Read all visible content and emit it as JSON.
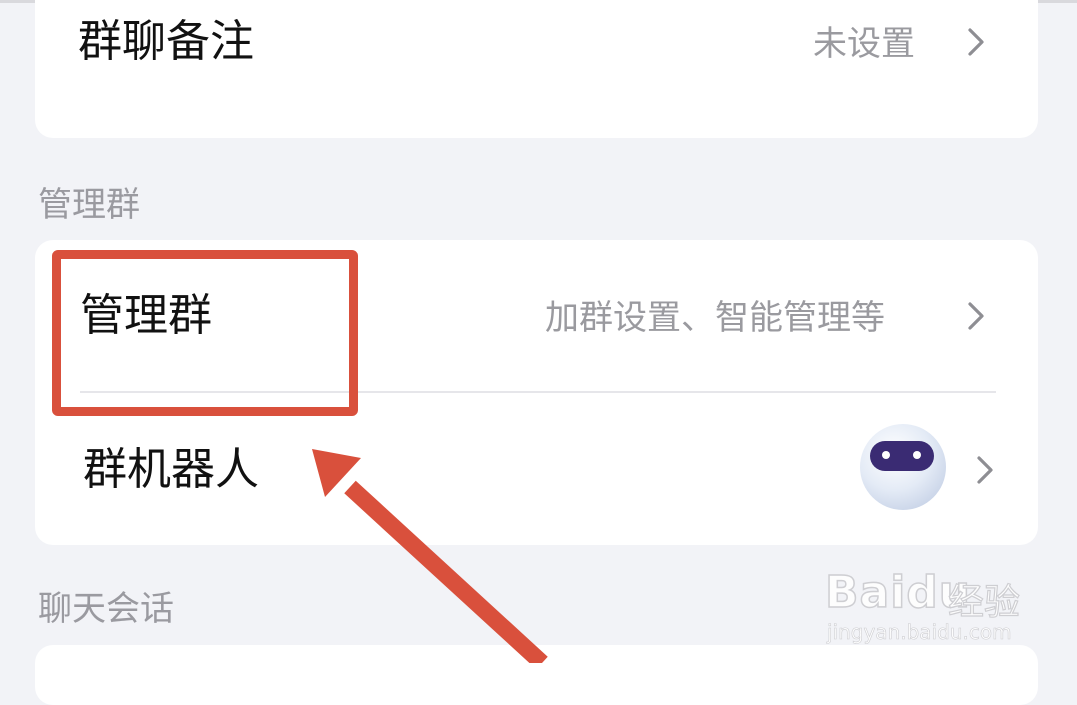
{
  "rows": {
    "group_remark": {
      "title": "群聊备注",
      "value": "未设置"
    },
    "manage_group": {
      "title": "管理群",
      "value": "加群设置、智能管理等"
    },
    "group_bot": {
      "title": "群机器人"
    }
  },
  "sections": {
    "manage_label": "管理群",
    "chat_label": "聊天会话"
  },
  "watermark": {
    "brand": "Baidu",
    "suffix": "经验",
    "url": "jingyan.baidu.com"
  },
  "colors": {
    "background": "#f2f3f7",
    "card": "#ffffff",
    "highlight": "#d9503c",
    "arrow": "#d9503c"
  },
  "icons": {
    "chevron": "chevron-right-icon",
    "bot_avatar": "robot-avatar-icon"
  }
}
